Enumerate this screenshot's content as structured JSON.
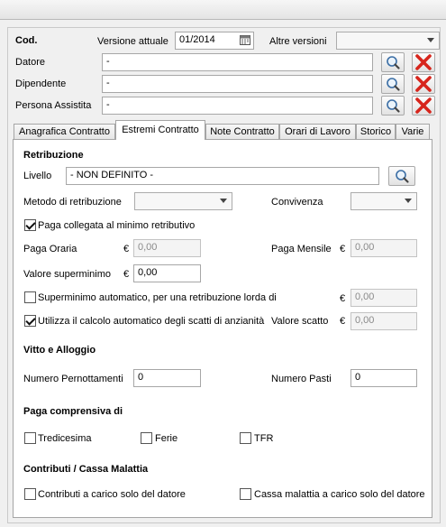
{
  "header": {
    "cod_label": "Cod.",
    "versione_label": "Versione attuale",
    "versione_value": "01/2014",
    "altre_versioni_label": "Altre versioni",
    "altre_versioni_value": ""
  },
  "rows": [
    {
      "label": "Datore",
      "value": "-"
    },
    {
      "label": "Dipendente",
      "value": "-"
    },
    {
      "label": "Persona Assistita",
      "value": "-"
    }
  ],
  "tabs": [
    {
      "label": "Anagrafica Contratto"
    },
    {
      "label": "Estremi Contratto"
    },
    {
      "label": "Note Contratto"
    },
    {
      "label": "Orari di Lavoro"
    },
    {
      "label": "Storico"
    },
    {
      "label": "Varie"
    }
  ],
  "active_tab": "Estremi Contratto",
  "retribuzione": {
    "title": "Retribuzione",
    "livello_label": "Livello",
    "livello_value": "- NON DEFINITO -",
    "metodo_label": "Metodo di retribuzione",
    "metodo_value": "",
    "convivenza_label": "Convivenza",
    "convivenza_value": "",
    "paga_collegata_label": "Paga collegata al minimo retributivo",
    "paga_collegata_checked": true,
    "currency": "€",
    "paga_oraria_label": "Paga Oraria",
    "paga_oraria_value": "0,00",
    "paga_mensile_label": "Paga Mensile",
    "paga_mensile_value": "0,00",
    "superminimo_label": "Valore superminimo",
    "superminimo_value": "0,00",
    "superminimo_auto_label": "Superminimo automatico, per una retribuzione lorda di",
    "superminimo_auto_checked": false,
    "superminimo_auto_value": "0,00",
    "scatti_label": "Utilizza il calcolo automatico degli scatti di anzianità",
    "scatti_checked": true,
    "valore_scatto_label": "Valore scatto",
    "valore_scatto_value": "0,00"
  },
  "vitto": {
    "title": "Vitto e Alloggio",
    "pernottamenti_label": "Numero Pernottamenti",
    "pernottamenti_value": "0",
    "pasti_label": "Numero Pasti",
    "pasti_value": "0"
  },
  "paga_comprensiva": {
    "title": "Paga comprensiva di",
    "items": [
      {
        "label": "Tredicesima",
        "checked": false
      },
      {
        "label": "Ferie",
        "checked": false
      },
      {
        "label": "TFR",
        "checked": false
      }
    ]
  },
  "contributi": {
    "title": "Contributi / Cassa Malattia",
    "items": [
      {
        "label": "Contributi a carico solo del datore",
        "checked": false
      },
      {
        "label": "Cassa malattia a carico solo del datore",
        "checked": false
      }
    ]
  },
  "icons": {
    "search": "magnifier-icon",
    "delete": "red-x-icon",
    "calendar": "calendar-icon"
  },
  "colors": {
    "delete_red": "#d7251c",
    "panel_bg": "#ffffff",
    "window_bg": "#f0f0f0"
  }
}
